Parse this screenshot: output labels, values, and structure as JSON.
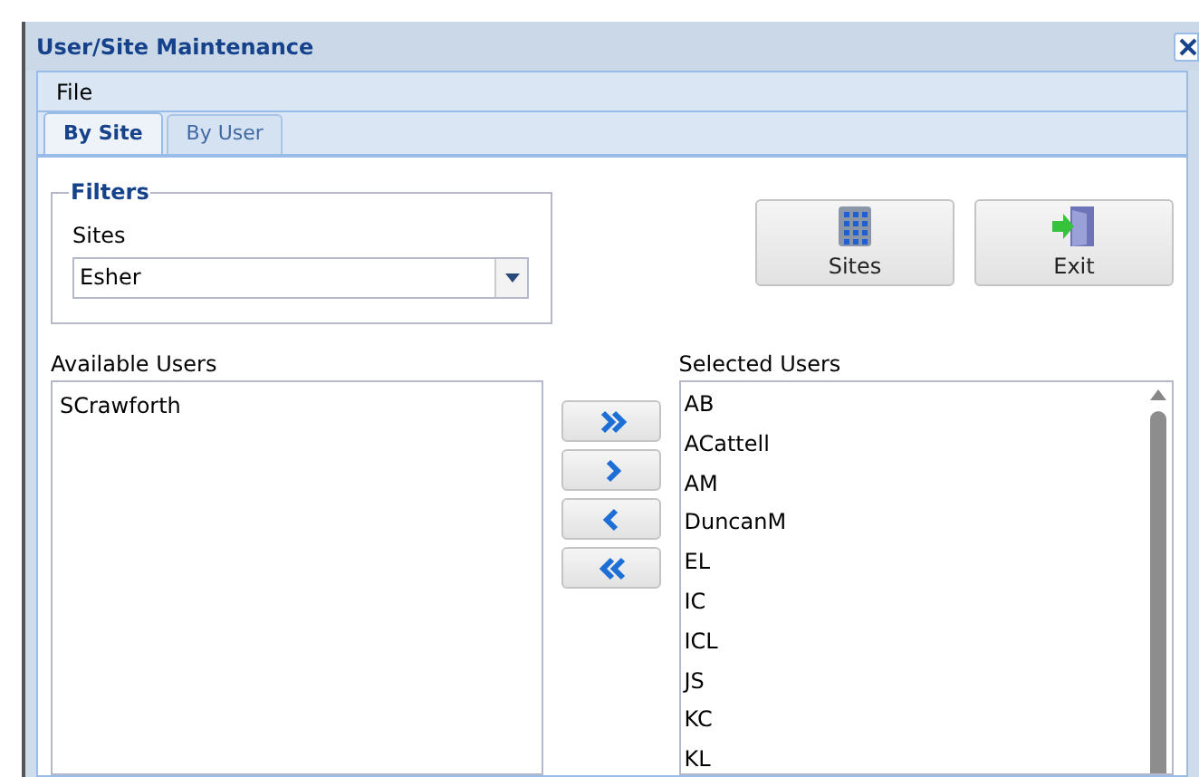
{
  "window": {
    "title": "User/Site Maintenance"
  },
  "menu": [
    "File"
  ],
  "tabs": [
    {
      "label": "By Site",
      "selected": true
    },
    {
      "label": "By User",
      "selected": false
    }
  ],
  "filters": {
    "title": "Filters",
    "sites_label": "Sites",
    "sites_value": "Esher"
  },
  "toolbar": [
    {
      "label": "Sites",
      "kind": "building"
    },
    {
      "label": "Exit",
      "kind": "exit"
    }
  ],
  "available_users": {
    "label": "Available Users",
    "items": [
      "SCrawforth"
    ]
  },
  "transfer_buttons": [
    {
      "kind": "add-all"
    },
    {
      "kind": "add"
    },
    {
      "kind": "remove"
    },
    {
      "kind": "remove-all"
    }
  ],
  "selected_users": {
    "label": "Selected Users",
    "items": [
      "AB",
      "ACattell",
      "AM",
      "DuncanM",
      "EL",
      "IC",
      "ICL",
      "JS",
      "KC",
      "KL"
    ]
  }
}
